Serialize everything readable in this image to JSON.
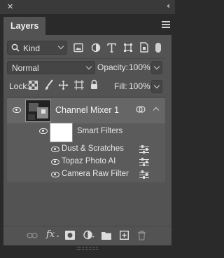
{
  "window": {
    "close_glyph": "✕",
    "collapse_glyph": "‹‹"
  },
  "panel": {
    "tab_label": "Layers",
    "menu_icon": "hamburger-menu-icon"
  },
  "filter_row": {
    "kind_label": "Kind",
    "filter_icons": [
      "image-filter-icon",
      "adjustment-filter-icon",
      "type-filter-icon",
      "shape-filter-icon",
      "smart-object-filter-icon",
      "filter-toggle-icon"
    ]
  },
  "blend_row": {
    "mode": "Normal",
    "opacity_label": "Opacity:",
    "opacity_value": "100%"
  },
  "lock_row": {
    "lock_label": "Lock:",
    "fill_label": "Fill:",
    "fill_value": "100%"
  },
  "layers": [
    {
      "name": "Channel Mixer 1",
      "visible": true,
      "selected": true,
      "smart_filters": {
        "label": "Smart Filters",
        "filters": [
          {
            "name": "Dust & Scratches"
          },
          {
            "name": "Topaz Photo AI"
          },
          {
            "name": "Camera Raw Filter"
          }
        ]
      }
    }
  ],
  "bottom_icons": [
    "link-layers-icon",
    "fx-icon",
    "layer-mask-icon",
    "adjustment-layer-icon",
    "group-folder-icon",
    "new-layer-icon",
    "trash-icon"
  ],
  "colors": {
    "panel_bg": "#535353",
    "selected_row": "#666666",
    "outer_bg": "#2a2a2a"
  }
}
